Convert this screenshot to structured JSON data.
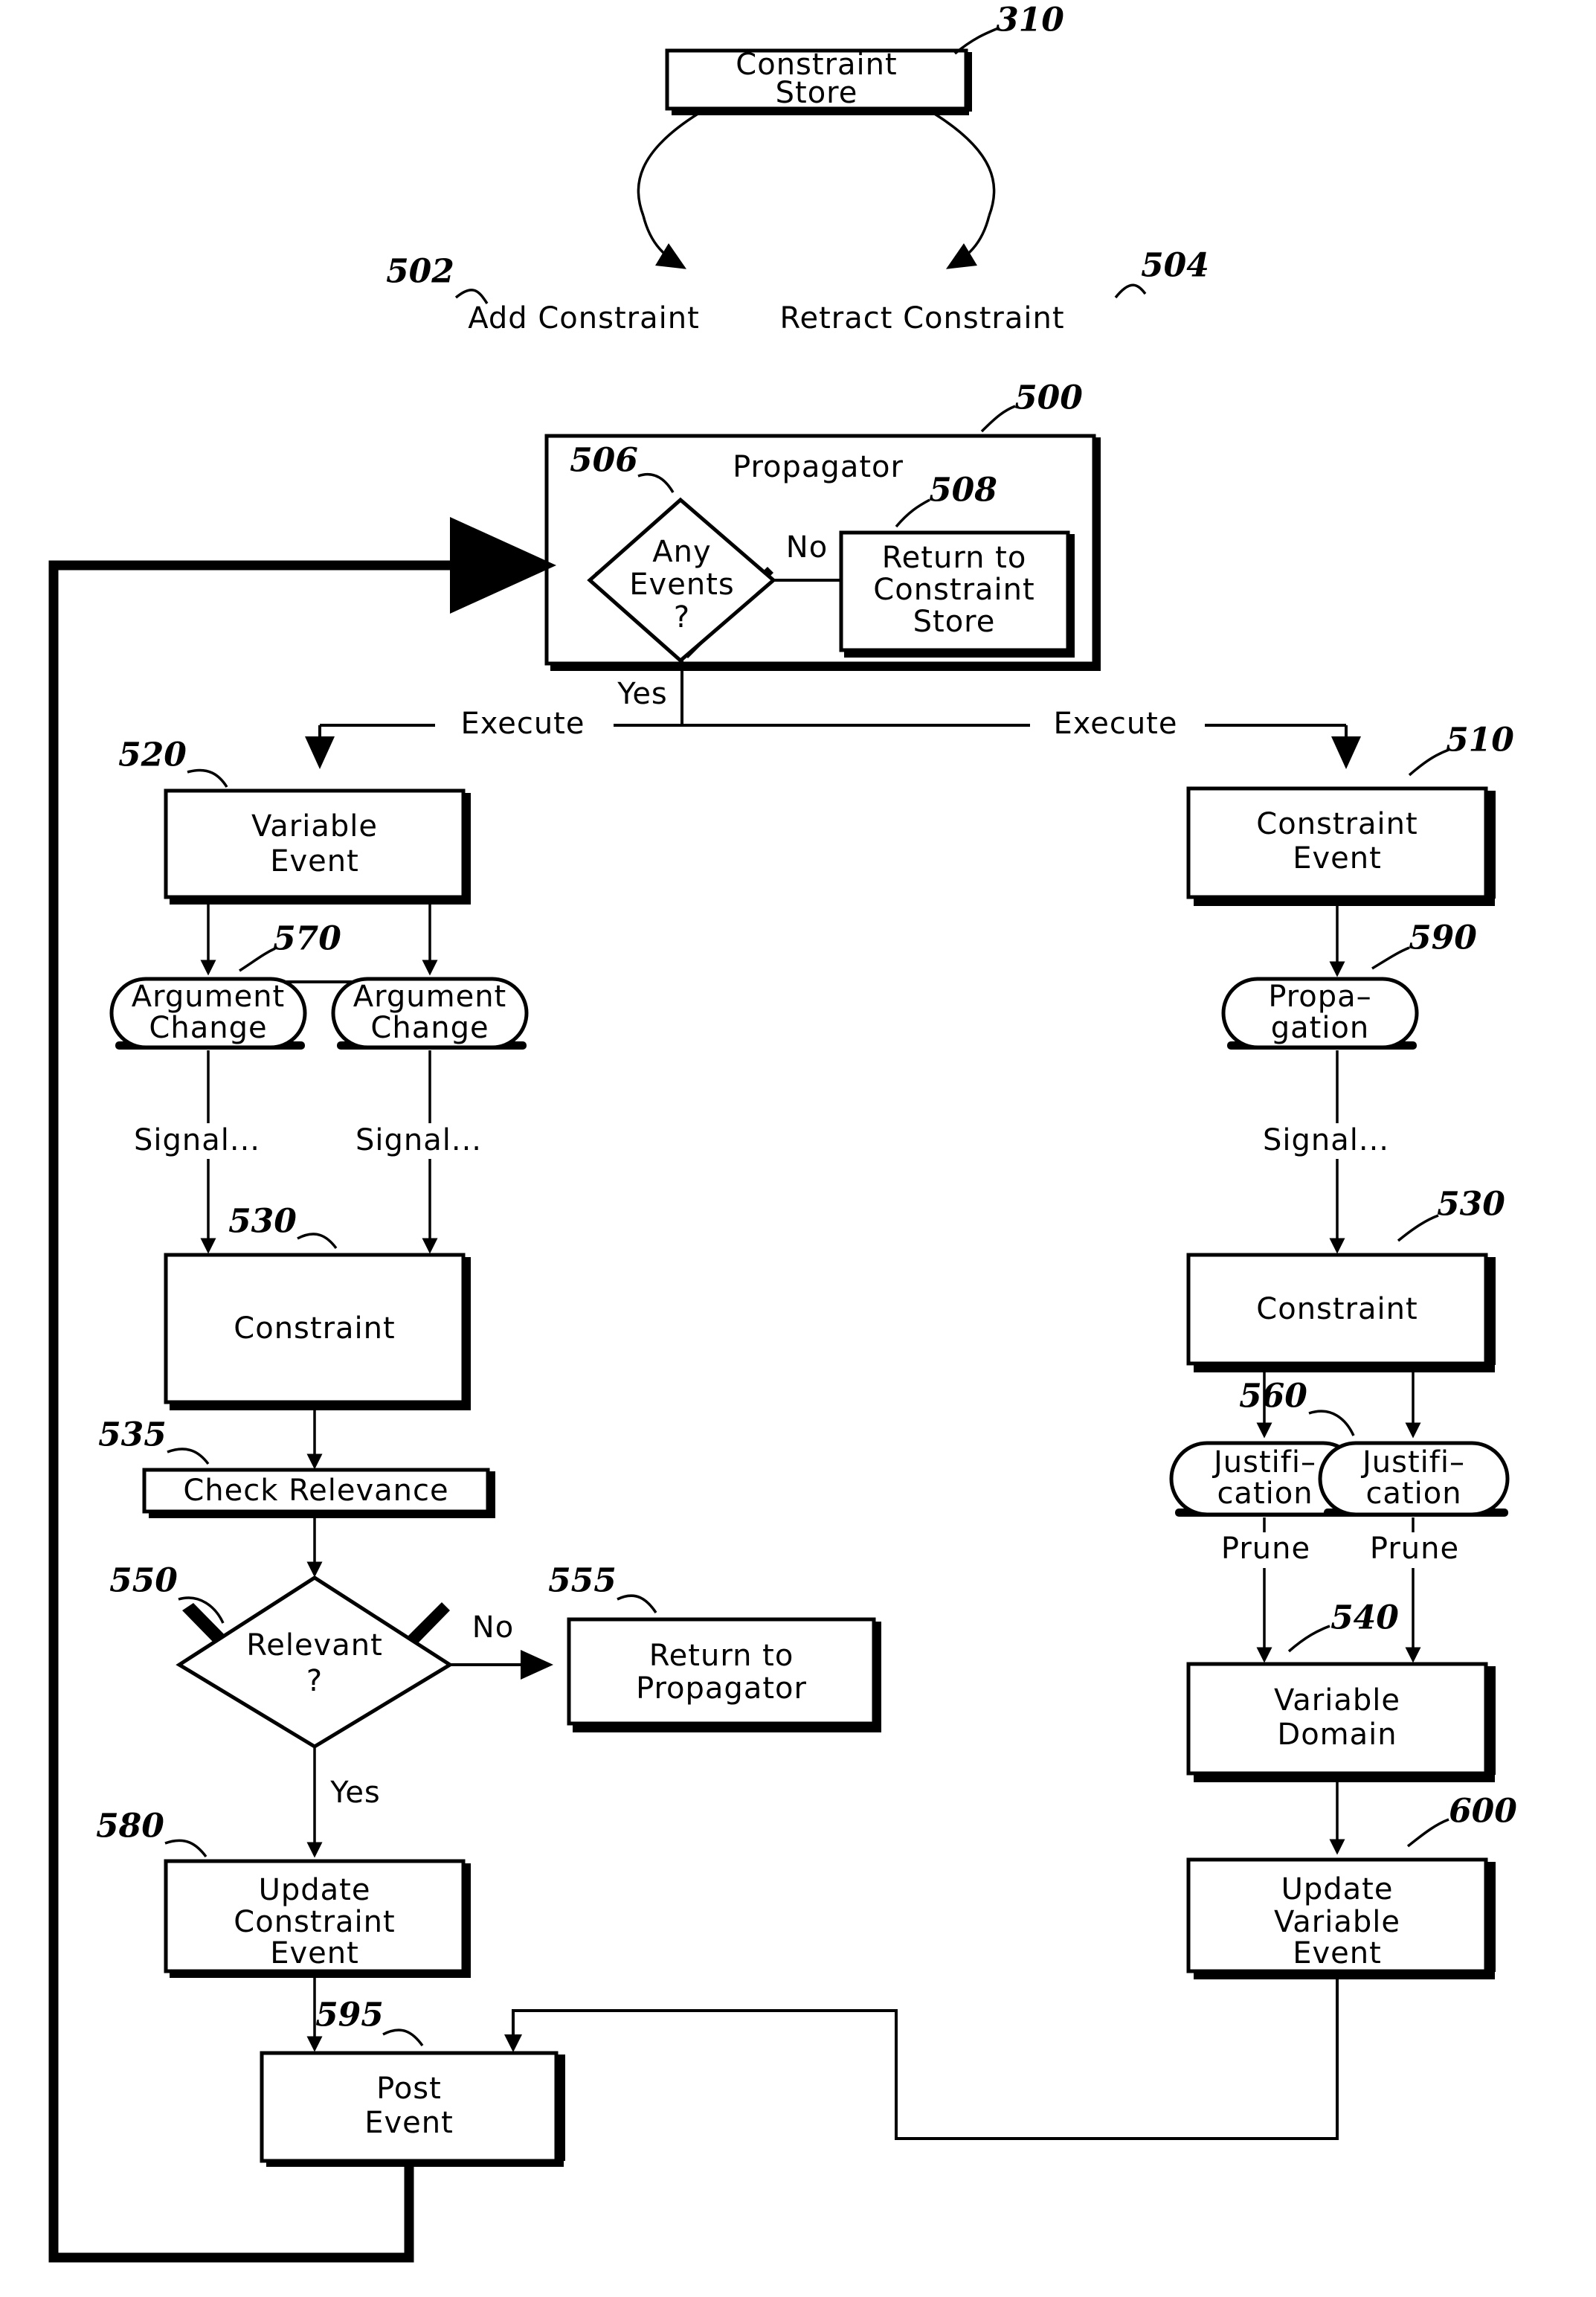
{
  "figure": {
    "type": "patent-flow-diagram",
    "background": "#ffffff",
    "line_color": "#000000"
  },
  "nodes": {
    "constraint_store": {
      "ref": "310",
      "line1": "Constraint",
      "line2": "Store"
    },
    "propagator": {
      "ref": "500",
      "title": "Propagator"
    },
    "any_events": {
      "ref": "506",
      "line1": "Any",
      "line2": "Events",
      "line3": "?"
    },
    "return_to_constraint_store": {
      "ref": "508",
      "line1": "Return  to",
      "line2": "Constraint",
      "line3": "Store"
    },
    "variable_event": {
      "ref": "520",
      "line1": "Variable",
      "line2": "Event"
    },
    "argument_change_left": {
      "ref": "570",
      "line1": "Argument",
      "line2": "Change"
    },
    "argument_change_right": {
      "ref": "",
      "line1": "Argument",
      "line2": "Change"
    },
    "constraint_left": {
      "ref": "530",
      "line1": "Constraint"
    },
    "check_relevance": {
      "ref": "535",
      "line1": "Check  Relevance"
    },
    "relevant": {
      "ref": "550",
      "line1": "Relevant",
      "line2": "?"
    },
    "return_to_propagator": {
      "ref": "555",
      "line1": "Return  to",
      "line2": "Propagator"
    },
    "update_constraint_event": {
      "ref": "580",
      "line1": "Update",
      "line2": "Constraint",
      "line3": "Event"
    },
    "post_event": {
      "ref": "595",
      "line1": "Post",
      "line2": "Event"
    },
    "constraint_event": {
      "ref": "510",
      "line1": "Constraint",
      "line2": "Event"
    },
    "propagation": {
      "ref": "590",
      "line1": "Propa–",
      "line2": "gation"
    },
    "constraint_right": {
      "ref": "530",
      "line1": "Constraint"
    },
    "justification_left": {
      "ref": "",
      "line1": "Justifi–",
      "line2": "cation"
    },
    "justification_right": {
      "ref": "560",
      "line1": "Justifi–",
      "line2": "cation"
    },
    "variable_domain": {
      "ref": "540",
      "line1": "Variable",
      "line2": "Domain"
    },
    "update_variable_event": {
      "ref": "600",
      "line1": "Update",
      "line2": "Variable",
      "line3": "Event"
    }
  },
  "edge_labels": {
    "add_constraint": {
      "ref": "502",
      "text": "Add  Constraint"
    },
    "retract_constraint": {
      "ref": "504",
      "text": "Retract  Constraint"
    },
    "no_from_any_events": "No",
    "yes_from_any_events": "Yes",
    "execute_left": "Execute",
    "execute_right": "Execute",
    "signal_left_a": "Signal...",
    "signal_left_b": "Signal...",
    "signal_right": "Signal...",
    "no_from_relevant": "No",
    "yes_from_relevant": "Yes",
    "prune_left": "Prune",
    "prune_right": "Prune"
  }
}
